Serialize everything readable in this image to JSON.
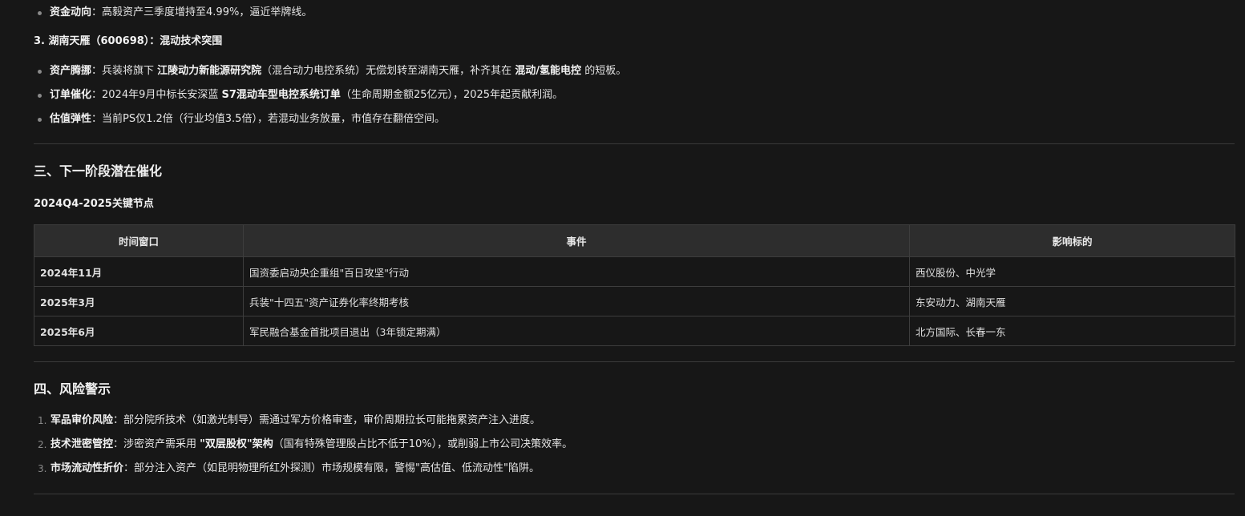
{
  "top_bullet": {
    "label": "资金动向",
    "text": "：高毅资产三季度增持至4.99%，逼近举牌线。"
  },
  "company3": {
    "heading": "3. 湖南天雁（600698）：混动技术突围",
    "bullets": [
      {
        "label": "资产腾挪",
        "pre": "：兵装将旗下 ",
        "bold1": "江陵动力新能源研究院",
        "mid": "（混合动力电控系统）无偿划转至湖南天雁，补齐其在 ",
        "bold2": "混动/氢能电控",
        "post": " 的短板。"
      },
      {
        "label": "订单催化",
        "pre": "：2024年9月中标长安深蓝 ",
        "bold1": "S7混动车型电控系统订单",
        "post": "（生命周期金额25亿元），2025年起贡献利润。"
      },
      {
        "label": "估值弹性",
        "text": "：当前PS仅1.2倍（行业均值3.5倍），若混动业务放量，市值存在翻倍空间。"
      }
    ]
  },
  "section3": {
    "title": "三、下一阶段潜在催化",
    "subtitle": "2024Q4-2025关键节点",
    "table": {
      "headers": [
        "时间窗口",
        "事件",
        "影响标的"
      ],
      "rows": [
        [
          "2024年11月",
          "国资委启动央企重组\"百日攻坚\"行动",
          "西仪股份、中光学"
        ],
        [
          "2025年3月",
          "兵装\"十四五\"资产证券化率终期考核",
          "东安动力、湖南天雁"
        ],
        [
          "2025年6月",
          "军民融合基金首批项目退出（3年锁定期满）",
          "北方国际、长春一东"
        ]
      ]
    }
  },
  "section4": {
    "title": "四、风险警示",
    "items": [
      {
        "num": "1.",
        "label": "军品审价风险",
        "text": "：部分院所技术（如激光制导）需通过军方价格审查，审价周期拉长可能拖累资产注入进度。"
      },
      {
        "num": "2.",
        "label": "技术泄密管控",
        "pre": "：涉密资产需采用 ",
        "bold1": "\"双层股权\"架构",
        "post": "（国有特殊管理股占比不低于10%），或削弱上市公司决策效率。"
      },
      {
        "num": "3.",
        "label": "市场流动性折价",
        "text": "：部分注入资产（如昆明物理所红外探测）市场规模有限，警惕\"高估值、低流动性\"陷阱。"
      }
    ]
  }
}
